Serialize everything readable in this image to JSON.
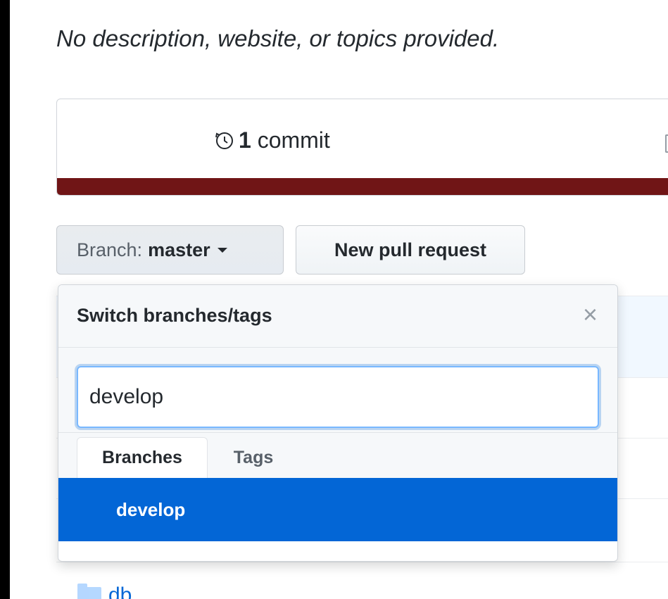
{
  "repo": {
    "description": "No description, website, or topics provided.",
    "summary": {
      "commits_count": "1",
      "commits_label": "commit",
      "language_bar_color": "#701516"
    }
  },
  "toolbar": {
    "branch_prefix": "Branch:",
    "branch_name": "master",
    "new_pr_label": "New pull request"
  },
  "branch_menu": {
    "title": "Switch branches/tags",
    "close_icon": "×",
    "filter_value": "develop",
    "tabs": [
      {
        "label": "Branches",
        "active": true
      },
      {
        "label": "Tags",
        "active": false
      }
    ],
    "results": [
      "develop"
    ]
  },
  "file_list": {
    "items": [
      {
        "name": "db",
        "icon": "folder-icon"
      }
    ]
  },
  "colors": {
    "accent": "#0366d6",
    "focus_ring": "#79b8ff"
  }
}
